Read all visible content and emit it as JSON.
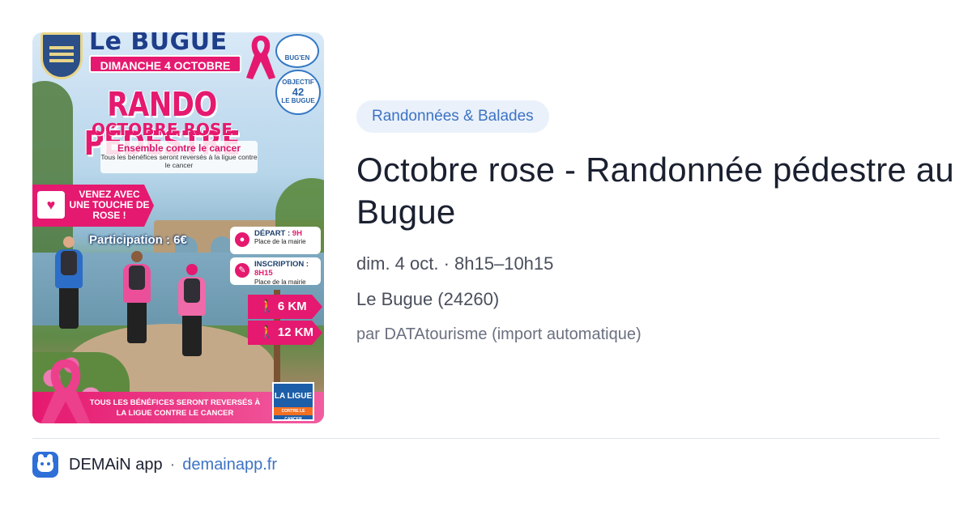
{
  "poster": {
    "town": "Le BUGUE",
    "date": "DIMANCHE 4 OCTOBRE",
    "logo1": "BUG'EN fêtes",
    "logo2_top": "OBJECTIF",
    "logo2_num": "42",
    "logo2_bottom": "LE BUGUE",
    "headline": "RANDO PÉDESTRE",
    "subheadline": "OCTOBRE ROSE",
    "cause": "Ensemble contre le cancer",
    "cause_note": "Tous les bénéfices seront reversés à la ligue contre le cancer",
    "venez": "VENEZ AVEC UNE TOUCHE DE ROSE !",
    "participation": "Participation : 6€",
    "depart_label": "DÉPART : ",
    "depart_time": "9H",
    "depart_place": "Place de la mairie",
    "inscription_label": "INSCRIPTION : ",
    "inscription_time": "8H15",
    "inscription_place": "Place de la mairie",
    "route1": "🚶 6 KM",
    "route2": "🚶 12 KM",
    "bottom_text": "TOUS LES BÉNÉFICES SERONT REVERSÉS À LA LIGUE CONTRE LE CANCER",
    "ligue": "LA LIGUE",
    "ligue_sub": "CONTRE LE CANCER"
  },
  "event": {
    "category": "Randonnées & Balades",
    "title": "Octobre rose - Randonnée pédestre au Bugue",
    "when": "dim. 4 oct. · 8h15–10h15",
    "where": "Le Bugue (24260)",
    "by": "par DATAtourisme (import automatique)"
  },
  "footer": {
    "app_name": "DEMAiN app",
    "separator": "·",
    "link": "demainapp.fr"
  },
  "colors": {
    "accent": "#3d73c4",
    "chip_bg": "#eaf1fb",
    "pink": "#e5196f",
    "text": "#1b2030",
    "muted": "#4a4f5c"
  },
  "icons": {
    "app": "demain-app-icon",
    "ribbon": "pink-ribbon-icon",
    "location": "map-pin-icon",
    "edit": "edit-icon",
    "walker": "hiker-icon"
  }
}
